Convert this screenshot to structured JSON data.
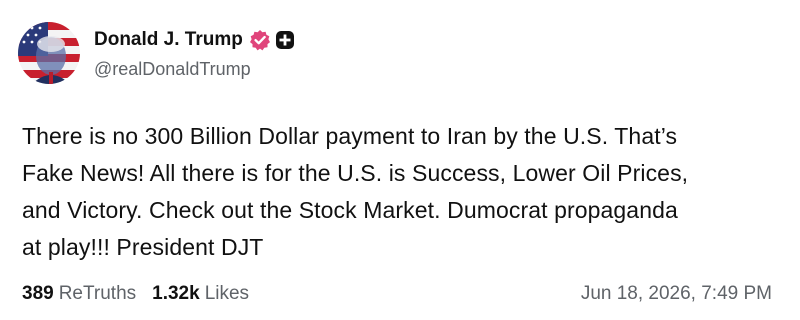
{
  "author": {
    "display_name": "Donald J. Trump",
    "handle": "@realDonaldTrump",
    "avatar_icon": "flag-portrait-avatar",
    "verified_icon": "verified-badge-icon",
    "verified_color": "#e0457b",
    "plus_icon": "plus-badge-icon"
  },
  "post": {
    "lines": [
      "There is no 300 Billion Dollar payment to Iran by the U.S. That’s",
      "Fake News! All there is for the U.S. is Success, Lower Oil Prices,",
      "and Victory. Check out the Stock Market. Dumocrat propaganda",
      "at play!!! President DJT"
    ]
  },
  "stats": {
    "retruths_count": "389",
    "retruths_label": "ReTruths",
    "likes_count": "1.32k",
    "likes_label": "Likes",
    "timestamp": "Jun 18, 2026, 7:49 PM"
  },
  "colors": {
    "text": "#111111",
    "muted": "#5f6368",
    "background": "#ffffff"
  }
}
